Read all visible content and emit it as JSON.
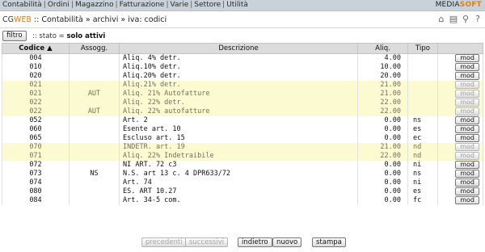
{
  "nav": {
    "items": [
      "Contabilità",
      "Ordini",
      "Magazzino",
      "Fatturazione",
      "Varie",
      "Settore",
      "Utilità"
    ],
    "brand_a": "MEDIA",
    "brand_b": "SOFT"
  },
  "breadcrumb": {
    "cg_a": "CG",
    "cg_b": "WEB",
    "path": " :: Contabilità » archivi » iva: codici"
  },
  "toolbar_icons": [
    "home-icon",
    "printer-icon",
    "search-icon",
    "help-icon"
  ],
  "filter": {
    "button": "filtro",
    "stato_prefix": ":: stato = ",
    "stato_value": "solo attivi"
  },
  "table": {
    "headers": [
      "Codice ▲",
      "Assogg.",
      "Descrizione",
      "Aliq.",
      "Tipo",
      ""
    ],
    "action_label": "mod",
    "rows": [
      {
        "codice": "004",
        "assogg": "",
        "descrizione": "Aliq. 4% detr.",
        "aliq": "4.00",
        "tipo": "",
        "highlight": false
      },
      {
        "codice": "010",
        "assogg": "",
        "descrizione": "Aliq.10% detr.",
        "aliq": "10.00",
        "tipo": "",
        "highlight": false
      },
      {
        "codice": "020",
        "assogg": "",
        "descrizione": "Aliq.20% detr.",
        "aliq": "20.00",
        "tipo": "",
        "highlight": false
      },
      {
        "codice": "021",
        "assogg": "",
        "descrizione": "Aliq.21% detr.",
        "aliq": "21.00",
        "tipo": "",
        "highlight": true
      },
      {
        "codice": "021",
        "assogg": "AUT",
        "descrizione": "Aliq. 21% Autofatture",
        "aliq": "21.00",
        "tipo": "",
        "highlight": true
      },
      {
        "codice": "022",
        "assogg": "",
        "descrizione": "Aliq. 22% detr.",
        "aliq": "22.00",
        "tipo": "",
        "highlight": true
      },
      {
        "codice": "022",
        "assogg": "AUT",
        "descrizione": "Aliq. 22% autofatture",
        "aliq": "22.00",
        "tipo": "",
        "highlight": true
      },
      {
        "codice": "052",
        "assogg": "",
        "descrizione": "Art. 2",
        "aliq": "0.00",
        "tipo": "ns",
        "highlight": false
      },
      {
        "codice": "060",
        "assogg": "",
        "descrizione": "Esente art. 10",
        "aliq": "0.00",
        "tipo": "es",
        "highlight": false
      },
      {
        "codice": "065",
        "assogg": "",
        "descrizione": "Escluso art. 15",
        "aliq": "0.00",
        "tipo": "ec",
        "highlight": false
      },
      {
        "codice": "070",
        "assogg": "",
        "descrizione": "INDETR. art. 19",
        "aliq": "21.00",
        "tipo": "nd",
        "highlight": true
      },
      {
        "codice": "071",
        "assogg": "",
        "descrizione": "Aliq. 22% Indetraibile",
        "aliq": "22.00",
        "tipo": "nd",
        "highlight": true
      },
      {
        "codice": "072",
        "assogg": "",
        "descrizione": "NI ART. 72 c3",
        "aliq": "0.00",
        "tipo": "ni",
        "highlight": false
      },
      {
        "codice": "073",
        "assogg": "NS",
        "descrizione": "N.S. art 13 c. 4 DPR633/72",
        "aliq": "0.00",
        "tipo": "ns",
        "highlight": false
      },
      {
        "codice": "074",
        "assogg": "",
        "descrizione": "Art. 74",
        "aliq": "0.00",
        "tipo": "ni",
        "highlight": false
      },
      {
        "codice": "080",
        "assogg": "",
        "descrizione": "ES. ART 10.27",
        "aliq": "0.00",
        "tipo": "es",
        "highlight": false
      },
      {
        "codice": "084",
        "assogg": "",
        "descrizione": "Art. 34-5 com.",
        "aliq": "0.00",
        "tipo": "fc",
        "highlight": false
      }
    ]
  },
  "pager": {
    "prev": "precedenti",
    "next": "successivi",
    "back": "indietro",
    "new": "nuovo",
    "print": "stampa"
  },
  "colors": {
    "nav_bg": "#c9d2d8",
    "highlight_row": "#fbfad0",
    "brand_accent": "#e07d1a"
  }
}
